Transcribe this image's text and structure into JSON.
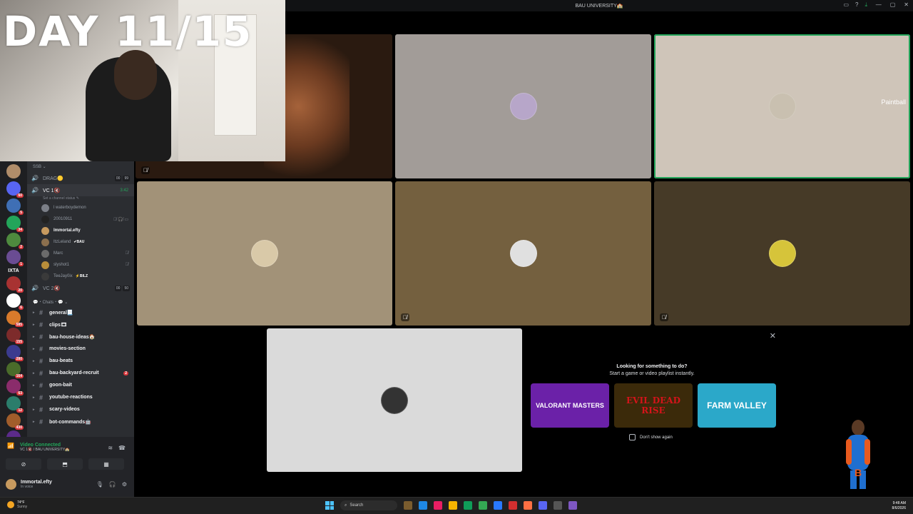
{
  "overlay": {
    "day_text": "DAY 11/15"
  },
  "window": {
    "title": "BAU UNIVERSITY🏫"
  },
  "servers": {
    "items": [
      {
        "color": "#b08d6a",
        "badge": ""
      },
      {
        "color": "#5865f2",
        "badge": "60"
      },
      {
        "color": "#3f6fb5",
        "badge": "5"
      },
      {
        "color": "#23a55a",
        "badge": "34"
      },
      {
        "color": "#4e8a3e",
        "badge": "2"
      },
      {
        "color": "#6a4c93",
        "badge": "1"
      }
    ],
    "text_label": "IXTA",
    "items2": [
      {
        "color": "#a83232",
        "badge": "20"
      },
      {
        "color": "#ffffff",
        "badge": "6"
      },
      {
        "color": "#d97a2b",
        "badge": "585"
      },
      {
        "color": "#7d2b2b",
        "badge": "155"
      },
      {
        "color": "#3b3b8f",
        "badge": "280"
      },
      {
        "color": "#4a6b2a",
        "badge": "164"
      },
      {
        "color": "#8a2c6b",
        "badge": "63"
      },
      {
        "color": "#2b7d6b",
        "badge": "12"
      },
      {
        "color": "#a15d2b",
        "badge": "430"
      },
      {
        "color": "#5b2b8a",
        "badge": "26"
      },
      {
        "color": "#2b4a8a",
        "badge": "NEW"
      }
    ]
  },
  "channels": {
    "category_top": "SSB ⌄",
    "drag": {
      "name": "DRAG🟡",
      "count1": "00",
      "count2": "99"
    },
    "vc1": {
      "name": "VC 1🔇",
      "time": "3:42",
      "status": "Set a channel status ✎"
    },
    "members": [
      {
        "name": "l waterboydemon",
        "tag": "",
        "live": false,
        "color": "#7b7f87",
        "icons": ""
      },
      {
        "name": "20010911",
        "tag": "",
        "live": false,
        "color": "#222222",
        "icons": "🎙̸ 🎧̸ ▭"
      },
      {
        "name": "Immortal.efty",
        "tag": "",
        "live": true,
        "color": "#c79a5f",
        "icons": ""
      },
      {
        "name": "ItzLeland",
        "tag": "✔BAU",
        "live": false,
        "color": "#8b6f4e",
        "icons": ""
      },
      {
        "name": "Marc",
        "tag": "",
        "live": false,
        "color": "#6b6b6b",
        "icons": "🎙̸"
      },
      {
        "name": "slyshot1",
        "tag": "",
        "live": false,
        "color": "#b88d3a",
        "icons": "🎙̸"
      },
      {
        "name": "TeeJay0ix",
        "tag": "⚡BILZ",
        "live": false,
        "color": "#3a3a3a",
        "icons": ""
      }
    ],
    "vc2": {
      "name": "VC 2🔇",
      "count1": "00",
      "count2": "50"
    },
    "chats_category": "💬・Chats・💬 ⌄",
    "text_channels": [
      {
        "name": "general📃",
        "bright": true,
        "ping": ""
      },
      {
        "name": "clips🎞",
        "bright": true,
        "ping": ""
      },
      {
        "name": "bau-house-ideas🏠",
        "bright": true,
        "ping": ""
      },
      {
        "name": "movies-section",
        "bright": true,
        "ping": ""
      },
      {
        "name": "bau-beats",
        "bright": true,
        "ping": ""
      },
      {
        "name": "bau-backyard-recruit",
        "bright": true,
        "ping": "2"
      },
      {
        "name": "goon-bait",
        "bright": true,
        "ping": ""
      },
      {
        "name": "youtube-reactions",
        "bright": true,
        "ping": ""
      },
      {
        "name": "scary-videos",
        "bright": true,
        "ping": ""
      },
      {
        "name": "bot-commands🤖",
        "bright": true,
        "ping": ""
      }
    ]
  },
  "voice_panel": {
    "status": "Video Connected",
    "sub": "VC 1🔇 / BAU UNIVERSITY🏫",
    "user_name": "Immortal.efty",
    "user_sub": "In voice"
  },
  "tiles": {
    "stream_label": "Paintball",
    "tile_colors": [
      "#2a1a10",
      "#a29c98",
      "#cfc5b9",
      "#a29278",
      "#74603f",
      "#463a27",
      "#dadada"
    ],
    "pfp_colors": [
      "",
      "#b7a6c9",
      "#c9c0b0",
      "#d9c9a8",
      "#e0e0e0",
      "#d6c43a",
      "#333333"
    ]
  },
  "activity": {
    "title": "Looking for something to do?",
    "subtitle": "Start a game or video playlist instantly.",
    "cards": [
      {
        "label": "VALORANT MASTERS",
        "bg": "#6b21a8",
        "fg": "#ffffff"
      },
      {
        "label": "EVIL DEAD RISE",
        "bg": "#3b2a0a",
        "fg": "#d4141a"
      },
      {
        "label": "FARM VALLEY",
        "bg": "#2ba8c9",
        "fg": "#ffffff"
      }
    ],
    "dont_show": "Don't show again"
  },
  "taskbar": {
    "weather_temp": "74°F",
    "weather_desc": "Sunny",
    "search_placeholder": "Search",
    "time": "9:48 AM",
    "date": "8/6/2026",
    "apps": [
      "#7a5c2e",
      "#1e88e5",
      "#e91e63",
      "#f4b400",
      "#0f9d58",
      "#34a853",
      "#2979ff",
      "#d32f2f",
      "#ff7043",
      "#5865f2",
      "#555555",
      "#7e57c2"
    ]
  }
}
